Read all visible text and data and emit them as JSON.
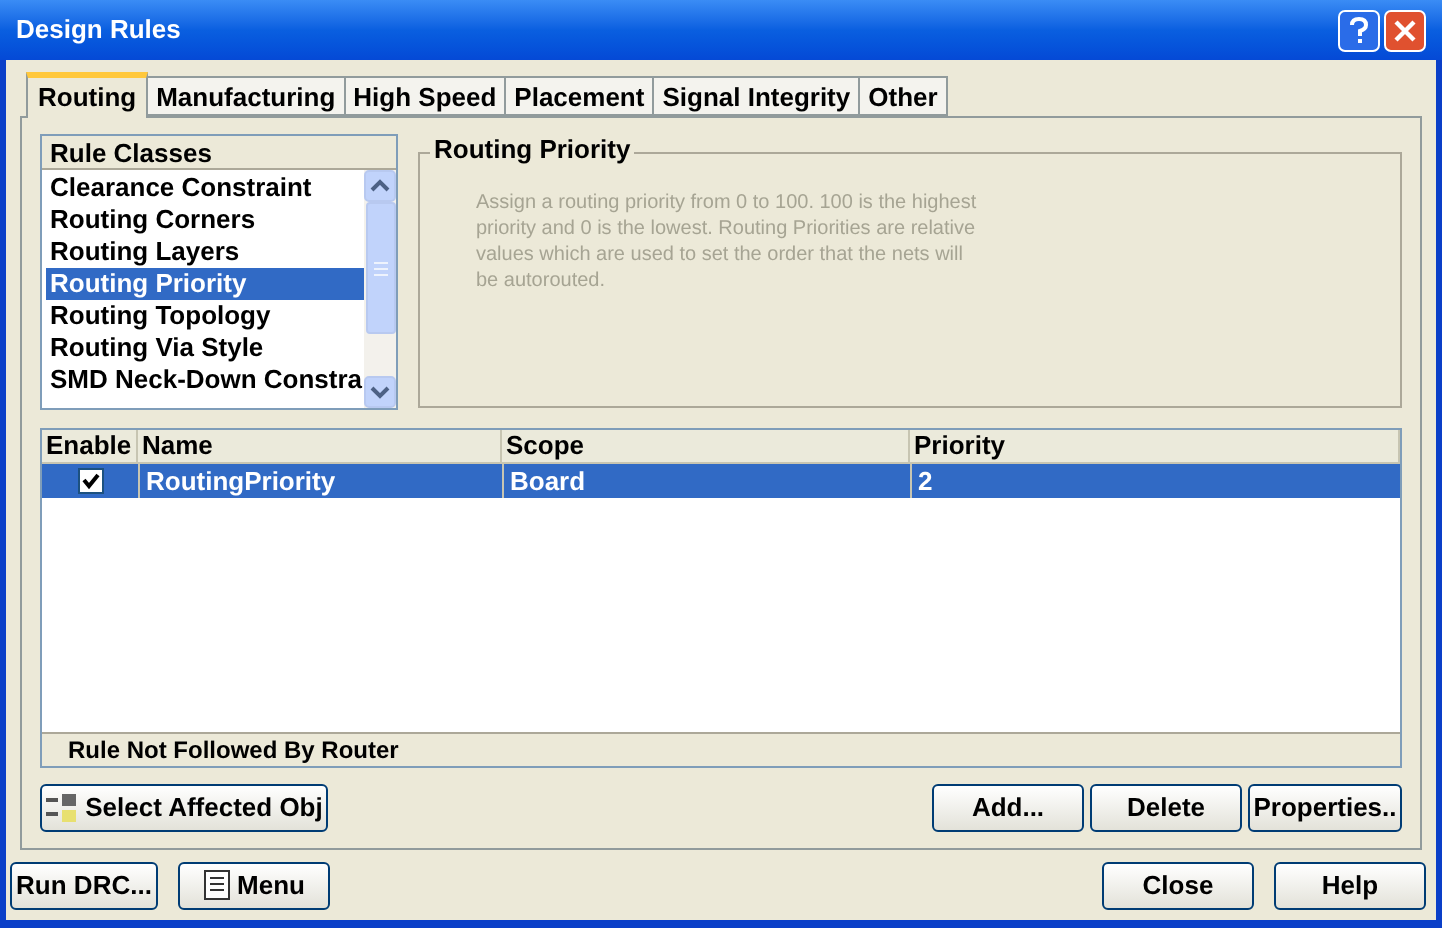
{
  "window": {
    "title": "Design Rules"
  },
  "tabs": [
    {
      "label": "Routing",
      "selected": true
    },
    {
      "label": "Manufacturing",
      "selected": false
    },
    {
      "label": "High Speed",
      "selected": false
    },
    {
      "label": "Placement",
      "selected": false
    },
    {
      "label": "Signal Integrity",
      "selected": false
    },
    {
      "label": "Other",
      "selected": false
    }
  ],
  "rule_classes": {
    "heading": "Rule Classes",
    "items": [
      {
        "label": "Clearance Constraint",
        "selected": false
      },
      {
        "label": "Routing Corners",
        "selected": false
      },
      {
        "label": "Routing Layers",
        "selected": false
      },
      {
        "label": "Routing Priority",
        "selected": true
      },
      {
        "label": "Routing Topology",
        "selected": false
      },
      {
        "label": "Routing Via Style",
        "selected": false
      },
      {
        "label": "SMD Neck-Down Constra",
        "selected": false
      }
    ]
  },
  "description": {
    "title": "Routing Priority",
    "text": "Assign a routing priority from 0 to 100. 100 is the highest priority and 0 is the lowest. Routing Priorities are relative values which are used to set the order that the nets will be autorouted."
  },
  "rules_table": {
    "columns": [
      "Enable",
      "Name",
      "Scope",
      "Priority"
    ],
    "rows": [
      {
        "enabled": true,
        "name": "RoutingPriority",
        "scope": "Board",
        "priority": "2",
        "selected": true
      }
    ],
    "status": "Rule Not Followed By Router"
  },
  "panel_buttons": [
    "Select Affected Obj",
    "Add...",
    "Delete",
    "Properties.."
  ],
  "footer_buttons": [
    "Run DRC...",
    "Menu",
    "Close",
    "Help"
  ]
}
